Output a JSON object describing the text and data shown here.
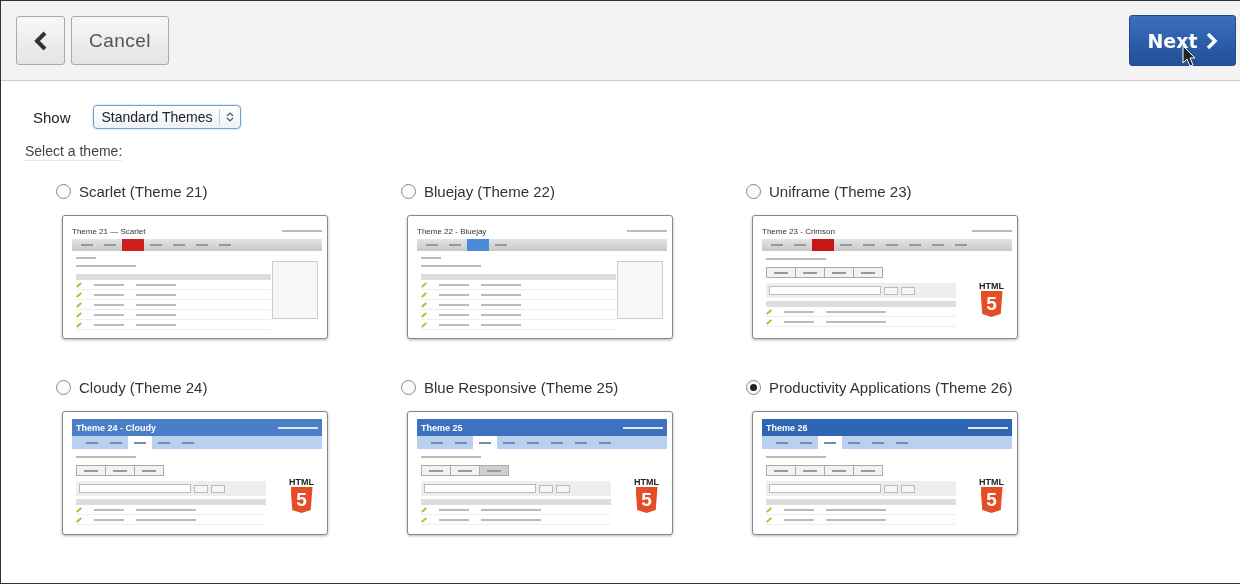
{
  "toolbar": {
    "cancel": "Cancel",
    "next": "Next"
  },
  "show": {
    "label": "Show",
    "value": "Standard Themes"
  },
  "prompt": "Select a theme:",
  "themes": [
    {
      "label": "Scarlet (Theme 21)",
      "selected": false,
      "preview": {
        "kind": "classic",
        "color": "#cc2020",
        "title": "Theme 21 — Scarlet",
        "tabs": [
          {
            "selected": false
          },
          {
            "selected": false
          },
          {
            "selected": true
          },
          {
            "selected": false
          },
          {
            "selected": false
          },
          {
            "selected": false
          },
          {
            "selected": false
          }
        ]
      }
    },
    {
      "label": "Bluejay (Theme 22)",
      "selected": false,
      "preview": {
        "kind": "classic",
        "color": "#4a8ad8",
        "title": "Theme 22 - Bluejay",
        "tabs": [
          {
            "selected": false
          },
          {
            "selected": false
          },
          {
            "selected": true
          },
          {
            "selected": false
          }
        ]
      }
    },
    {
      "label": "Uniframe (Theme 23)",
      "selected": false,
      "preview": {
        "kind": "classic",
        "color": "#c41818",
        "title": "Theme 23 - Crimson",
        "tabs": [
          {
            "selected": false
          },
          {
            "selected": false
          },
          {
            "selected": true
          },
          {
            "selected": false
          },
          {
            "selected": false
          },
          {
            "selected": false
          },
          {
            "selected": false
          },
          {
            "selected": false
          },
          {
            "selected": false
          }
        ],
        "buttons": [
          {
            "selected": false
          },
          {
            "selected": false
          },
          {
            "selected": false
          },
          {
            "selected": false
          }
        ],
        "html5": {
          "label": "HTML",
          "digit": "5"
        }
      }
    },
    {
      "label": "Cloudy (Theme 24)",
      "selected": false,
      "preview": {
        "kind": "banner",
        "color": "#4a7fc8",
        "title": "Theme 24 - Cloudy",
        "tabs": [
          {
            "selected": false
          },
          {
            "selected": false
          },
          {
            "selected": true
          },
          {
            "selected": false
          },
          {
            "selected": false
          }
        ],
        "buttons": [
          {
            "selected": false
          },
          {
            "selected": false
          },
          {
            "selected": false
          }
        ],
        "html5": {
          "label": "HTML",
          "digit": "5"
        }
      }
    },
    {
      "label": "Blue Responsive (Theme 25)",
      "selected": false,
      "preview": {
        "kind": "banner",
        "color": "#3d72c0",
        "title": "Theme 25",
        "tabs": [
          {
            "selected": false
          },
          {
            "selected": false
          },
          {
            "selected": true
          },
          {
            "selected": false
          },
          {
            "selected": false
          },
          {
            "selected": false
          },
          {
            "selected": false
          },
          {
            "selected": false
          }
        ],
        "buttons": [
          {
            "selected": false
          },
          {
            "selected": false
          },
          {
            "selected": true
          }
        ],
        "html5": {
          "label": "HTML",
          "digit": "5"
        }
      }
    },
    {
      "label": "Productivity Applications (Theme 26)",
      "selected": true,
      "preview": {
        "kind": "banner",
        "color": "#2f66b3",
        "title": "Theme 26",
        "tabs": [
          {
            "selected": false
          },
          {
            "selected": false
          },
          {
            "selected": true
          },
          {
            "selected": false
          },
          {
            "selected": false
          },
          {
            "selected": false
          }
        ],
        "buttons": [
          {
            "selected": false
          },
          {
            "selected": false
          },
          {
            "selected": false
          },
          {
            "selected": false
          }
        ],
        "html5": {
          "label": "HTML",
          "digit": "5"
        }
      }
    }
  ]
}
